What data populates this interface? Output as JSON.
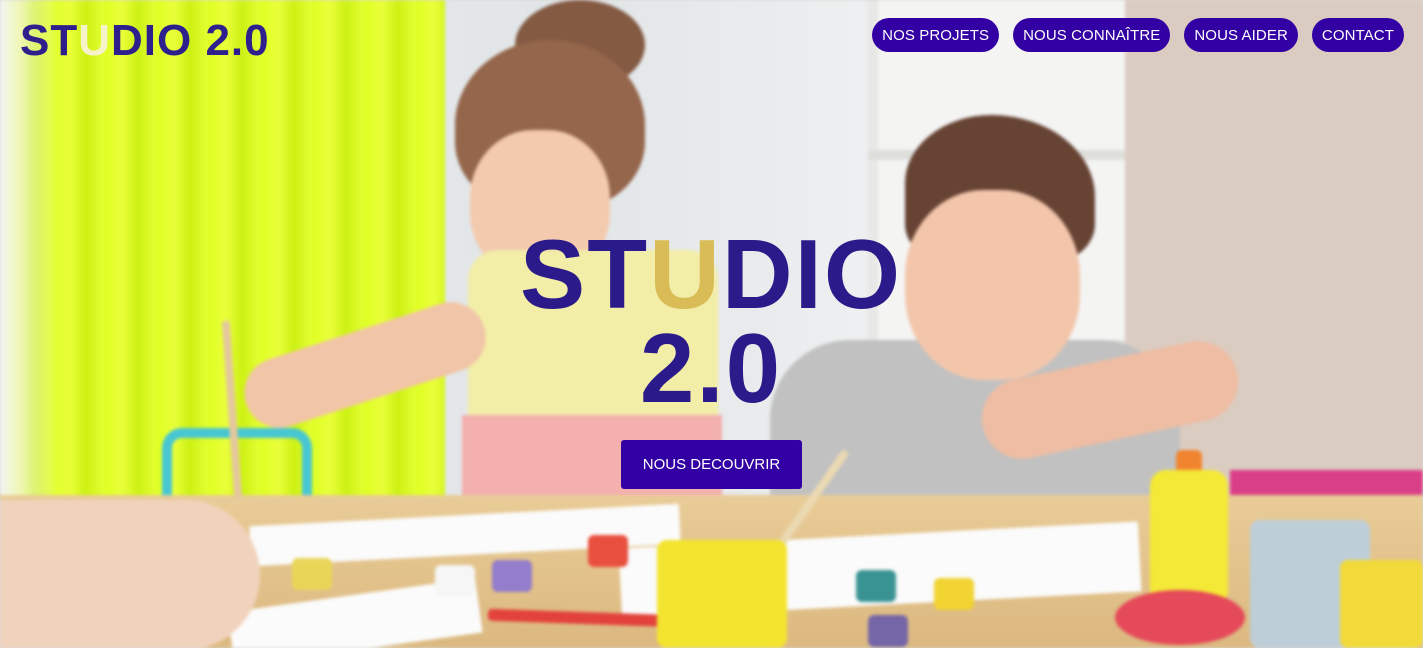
{
  "header": {
    "logo": {
      "prefix": "ST",
      "accent": "U",
      "suffix": "DIO 2.0"
    },
    "nav": [
      {
        "label": "NOS PROJETS"
      },
      {
        "label": "NOUS CONNAÎTRE"
      },
      {
        "label": "NOUS AIDER"
      },
      {
        "label": "CONTACT"
      }
    ]
  },
  "hero": {
    "title_prefix": "ST",
    "title_accent": "U",
    "title_suffix": "DIO",
    "title_line2": "2.0",
    "cta_label": "NOUS DECOUVRIR",
    "background_icon": "kids-painting-photo"
  },
  "colors": {
    "brand": "#3300a4",
    "title": "#2b1a8a",
    "accent": "#d9bc56"
  }
}
